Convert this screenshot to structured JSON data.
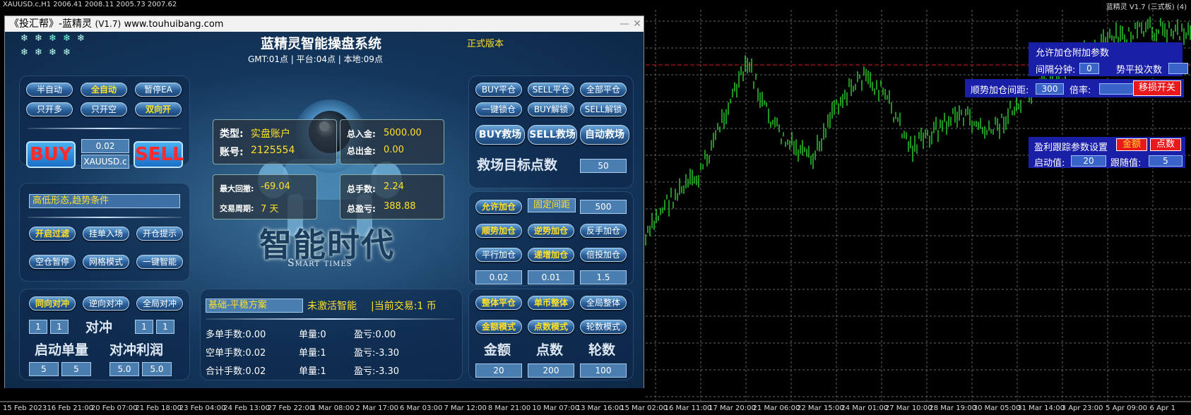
{
  "chart": {
    "symbol_info": "XAUUSD.c,H1  2006.41 2008.11 2005.73 2007.62",
    "ea_info": "蓝精灵 V1.7 (三式板) (4)",
    "x_labels": [
      "15 Feb 2023",
      "16 Feb 21:00",
      "20 Feb 07:00",
      "21 Feb 18:00",
      "23 Feb 04:00",
      "24 Feb 13:00",
      "27 Feb 22:00",
      "1 Mar 08:00",
      "2 Mar 17:00",
      "6 Mar 03:00",
      "7 Mar 12:00",
      "8 Mar 21:00",
      "10 Mar 07:00",
      "13 Mar 16:00",
      "15 Mar 02:00",
      "16 Mar 11:00",
      "17 Mar 20:00",
      "21 Mar 06:00",
      "22 Mar 15:00",
      "24 Mar 01:00",
      "27 Mar 10:00",
      "28 Mar 19:00",
      "30 Mar 05:00",
      "31 Mar 14:00",
      "3 Apr 23:00",
      "5 Apr 09:00",
      "6 Apr 1"
    ],
    "candle_color": "#2ed32e",
    "grid_color": "#5a6a5a"
  },
  "window": {
    "title": "《投汇帮》-蓝精灵",
    "version": "(V1.7)",
    "site": "www.touhuibang.com",
    "minimize": "—",
    "close": "✕"
  },
  "header": {
    "title": "蓝精灵智能操盘系统",
    "edition": "正式版本",
    "time_line": "GMT:01点 | 平台:04点 | 本地:09点"
  },
  "mode_panel": {
    "buttons": [
      "半自动",
      "全自动",
      "暂停EA",
      "只开多",
      "只开空",
      "双向开"
    ],
    "buy": "BUY",
    "sell": "SELL",
    "lot": "0.02",
    "symbol": "XAUUSD.c"
  },
  "filter_panel": {
    "condition": "高低形态,趋势条件",
    "buttons": [
      "开启过滤",
      "挂单入场",
      "开仓提示",
      "空仓暂停",
      "网格模式",
      "一键智能"
    ]
  },
  "hedge_panel": {
    "buttons": [
      "同向对冲",
      "逆向对冲",
      "全局对冲"
    ],
    "title": "对冲",
    "left_vals": [
      "1",
      "1"
    ],
    "right_vals": [
      "1",
      "1"
    ],
    "start_lot_label": "启动单量",
    "profit_label": "对冲利润",
    "start_lot_vals": [
      "5",
      "5"
    ],
    "profit_vals": [
      "5.0",
      "5.0"
    ]
  },
  "account": {
    "type_label": "类型:",
    "type_value": "实盘账户",
    "account_label": "账号:",
    "account_value": "2125554",
    "deposit_label": "总入金:",
    "deposit_value": "5000.00",
    "withdraw_label": "总出金:",
    "withdraw_value": "0.00",
    "drawdown_label": "最大回撤:",
    "drawdown_value": "-69.04",
    "period_label": "交易周期:",
    "period_value": "7 天",
    "lots_label": "总手数:",
    "lots_value": "2.24",
    "pl_label": "总盈亏:",
    "pl_value": "388.88",
    "brand_cn": "智能时代",
    "brand_en": "Smart times"
  },
  "plan_panel": {
    "plan": "基础-平稳方案",
    "status": "未激活智能",
    "current": "|当前交易:1 币",
    "rows": [
      {
        "a": "多单手数:0.00",
        "b": "单量:0",
        "c": "盈亏:0.00"
      },
      {
        "a": "空单手数:0.02",
        "b": "单量:1",
        "c": "盈亏:-3.30"
      },
      {
        "a": "合计手数:0.02",
        "b": "单量:1",
        "c": "盈亏:-3.30"
      }
    ]
  },
  "close_panel": {
    "buttons": [
      "BUY平仓",
      "SELL平仓",
      "全部平仓",
      "一键锁仓",
      "BUY解锁",
      "SELL解锁"
    ],
    "rescue": [
      "BUY救场",
      "SELL救场",
      "自动救场"
    ],
    "target_label": "救场目标点数",
    "target_value": "50"
  },
  "add_panel": {
    "allow": "允许加仓",
    "fixed": "固定间距",
    "fixed_value": "500",
    "buttons": [
      "顺势加仓",
      "逆势加仓",
      "反手加仓",
      "平行加仓",
      "递增加仓",
      "倍投加仓"
    ],
    "values": [
      "0.02",
      "0.01",
      "1.5"
    ]
  },
  "whole_panel": {
    "buttons": [
      "整体平仓",
      "单币整体",
      "全局整体",
      "金额模式",
      "点数模式",
      "轮数模式"
    ],
    "labels": [
      "金额",
      "点数",
      "轮数"
    ],
    "values": [
      "20",
      "200",
      "100"
    ]
  },
  "overlay": {
    "add_params_title": "允许加仓附加参数",
    "interval_label": "间隔分钟:",
    "interval_value": "0",
    "flat_label": "势平投次数",
    "trend_gap_label": "顺势加仓间距:",
    "trend_gap_value": "300",
    "rate_label": "倍率:",
    "rate_value": "",
    "switch_btn": "移损开关",
    "trail_title": "盈利跟踪参数设置",
    "amount_btn": "金额",
    "points_btn": "点数",
    "start_label": "启动值:",
    "start_value": "20",
    "follow_label": "跟随值:",
    "follow_value": "5"
  }
}
